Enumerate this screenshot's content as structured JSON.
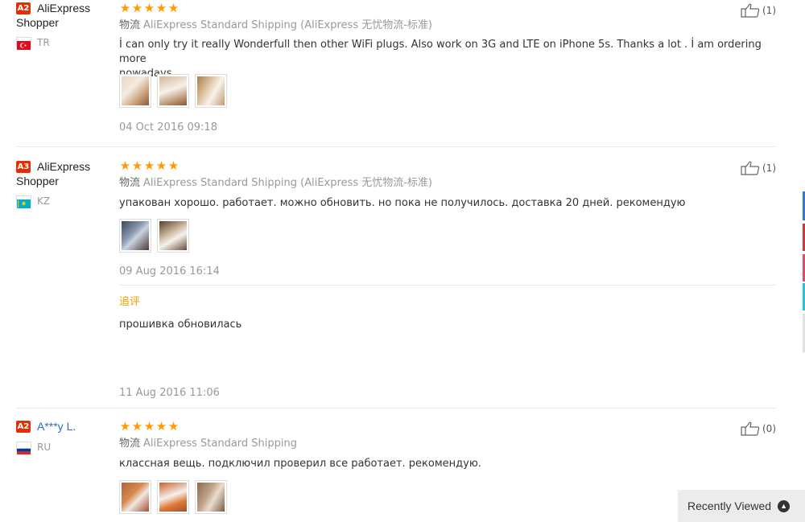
{
  "reviews": [
    {
      "level": "A2",
      "user_line1": "AliExpress",
      "user_line2": "Shopper",
      "country": "TR",
      "stars": "★★★★★",
      "logistics_label": "物流",
      "logistics": "AliExpress Standard Shipping (AliExpress 无忧物流-标准)",
      "text_line1": "İ can only try it really Wonderfull then other WiFi plugs. Also work on 3G and LTE on iPhone 5s. Thanks a lot . İ am ordering more",
      "text_line2": "nowadays.",
      "date": "04 Oct 2016 09:18",
      "likes": "(1)"
    },
    {
      "level": "A3",
      "user_line1": "AliExpress",
      "user_line2": "Shopper",
      "country": "KZ",
      "stars": "★★★★★",
      "logistics_label": "物流",
      "logistics": "AliExpress Standard Shipping (AliExpress 无忧物流-标准)",
      "text_line1": "упакован хорошо. работает. можно обновить. но пока не получилось. доставка 20 дней. рекомендую",
      "date": "09 Aug 2016 16:14",
      "followup_label": "追评",
      "followup_text": "прошивка обновилась",
      "followup_date": "11 Aug 2016 11:06",
      "likes": "(1)"
    },
    {
      "level": "A2",
      "user_line1": "A***y L.",
      "country": "RU",
      "stars": "★★★★★",
      "logistics_label": "物流",
      "logistics": "AliExpress Standard Shipping",
      "text_line1": "классная вещь. подключил проверил все работает. рекомендую.",
      "likes": "(0)"
    }
  ],
  "recently_viewed": "Recently Viewed",
  "colors": {
    "badge": "#e62e04",
    "star": "#ff9a00",
    "followup": "#f0a000",
    "link": "#2d6bc6"
  }
}
